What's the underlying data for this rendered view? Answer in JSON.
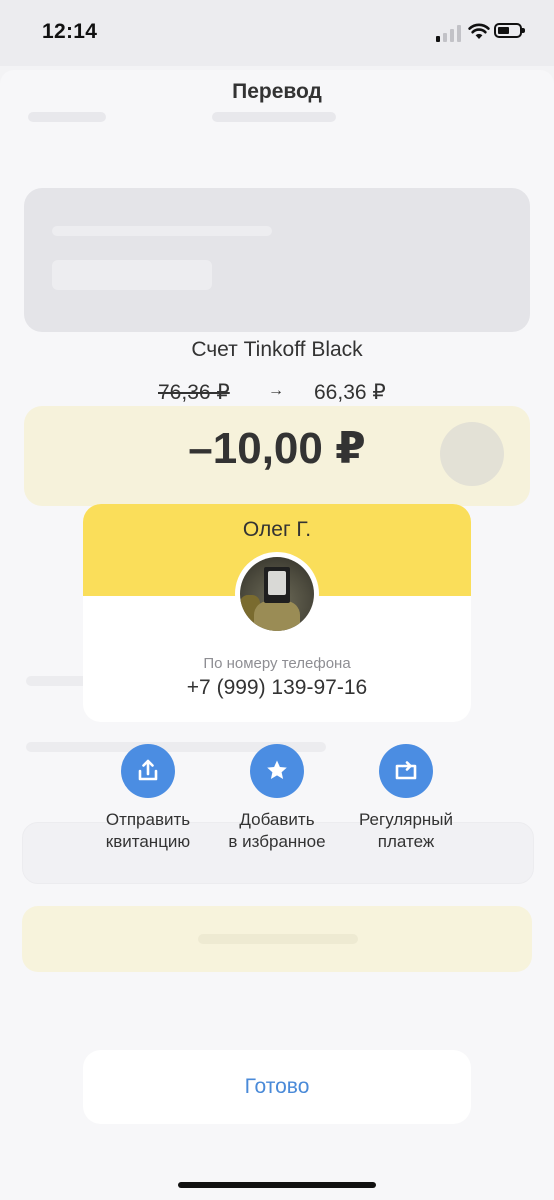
{
  "status_bar": {
    "time": "12:14"
  },
  "header": {
    "title": "Перевод"
  },
  "account": {
    "name": "Счет Tinkoff Black",
    "old_balance": "76,36 ₽",
    "new_balance": "66,36 ₽",
    "arrow": "→",
    "amount": "–10,00 ₽"
  },
  "recipient": {
    "name": "Олег Г.",
    "method_label": "По номеру телефона",
    "phone": "+7 (999) 139-97-16"
  },
  "actions": [
    {
      "line1": "Отправить",
      "line2": "квитанцию",
      "icon": "share-upload-icon"
    },
    {
      "line1": "Добавить",
      "line2": "в избранное",
      "icon": "star-icon"
    },
    {
      "line1": "Регулярный",
      "line2": "платеж",
      "icon": "repeat-icon"
    }
  ],
  "footer": {
    "done_label": "Готово"
  },
  "colors": {
    "accent_yellow": "#fade5a",
    "action_blue": "#4b8de2",
    "link_blue": "#4a8ad8"
  }
}
